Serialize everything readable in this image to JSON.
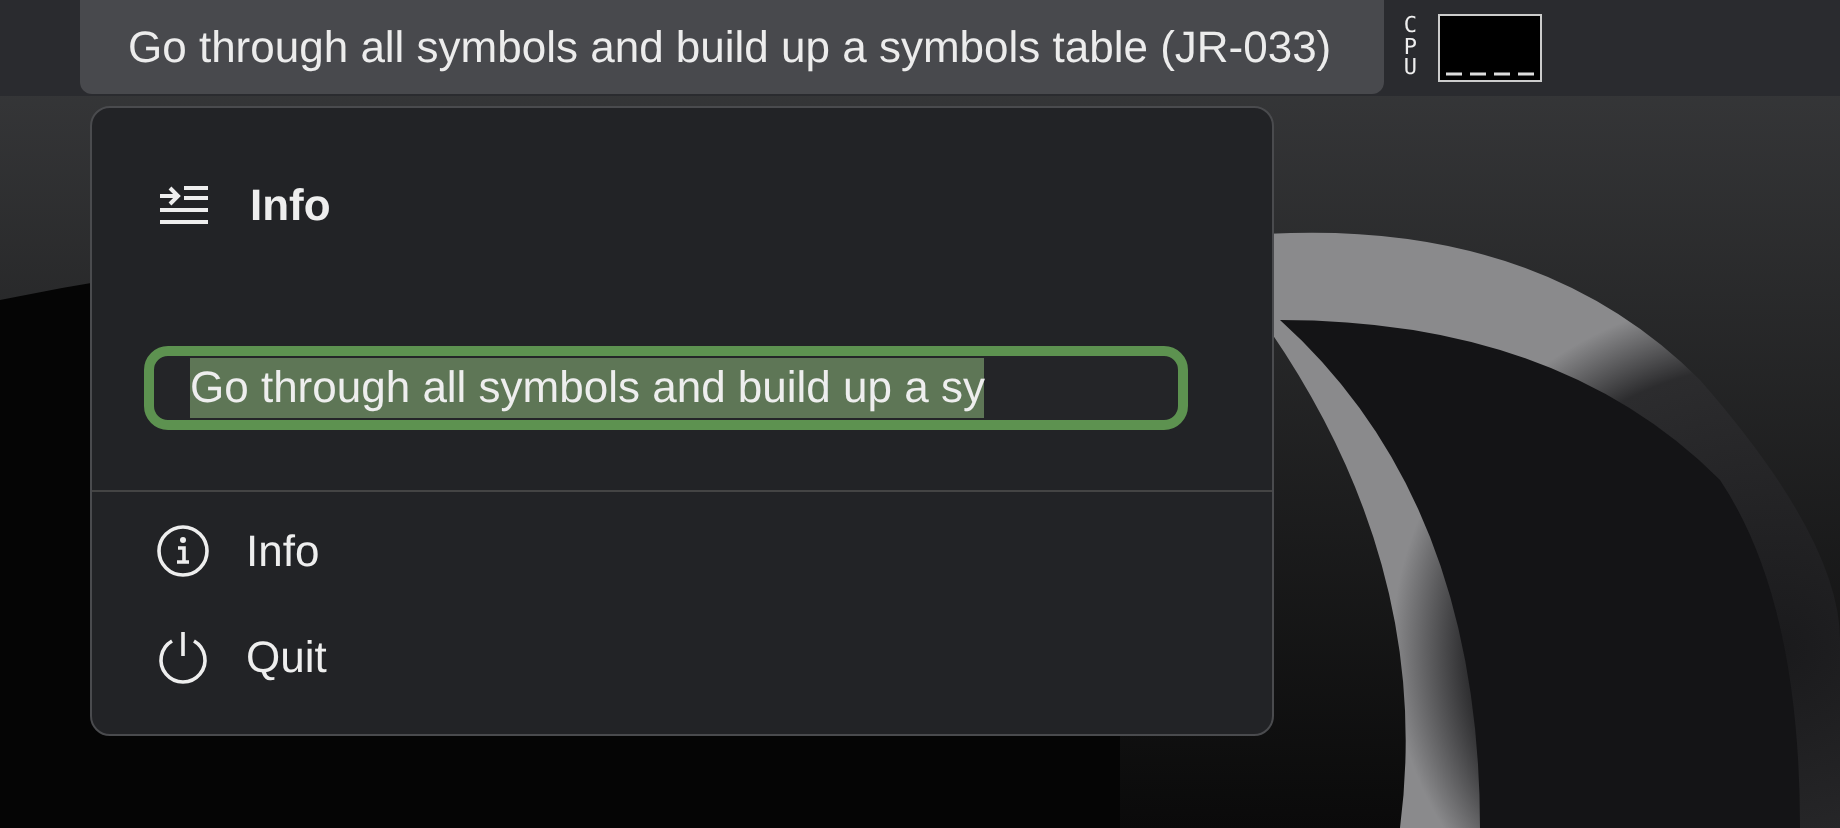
{
  "menu_bar": {
    "title": "Go through all symbols and build up a symbols table (JR-033)",
    "cpu_label": "CPU"
  },
  "popover": {
    "header": {
      "title": "Info"
    },
    "field": {
      "value": "Go through all symbols and build up a sy",
      "text_selected": true,
      "focused": true
    },
    "items": [
      {
        "kind": "info",
        "label": "Info"
      },
      {
        "kind": "quit",
        "label": "Quit"
      }
    ]
  }
}
